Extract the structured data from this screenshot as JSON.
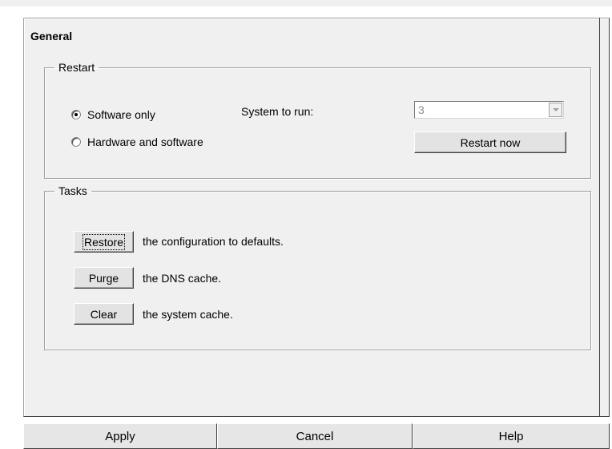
{
  "panel": {
    "title": "General"
  },
  "restart": {
    "legend": "Restart",
    "options": [
      {
        "label": "Software only",
        "selected": true
      },
      {
        "label": "Hardware and software",
        "selected": false
      }
    ],
    "system_label": "System to run:",
    "system_value": "3",
    "restart_button": "Restart now"
  },
  "tasks": {
    "legend": "Tasks",
    "items": [
      {
        "button": "Restore",
        "text": "the configuration to defaults.",
        "focused": true
      },
      {
        "button": "Purge",
        "text": "the DNS cache.",
        "focused": false
      },
      {
        "button": "Clear",
        "text": "the system cache.",
        "focused": false
      }
    ]
  },
  "footer": {
    "apply": "Apply",
    "cancel": "Cancel",
    "help": "Help"
  },
  "icons": {
    "radio_selected": "radio-selected-icon",
    "radio_unselected": "radio-unselected-icon",
    "combo_arrow": "chevron-down-icon"
  },
  "colors": {
    "panel_bg": "#f0f0f0",
    "button_bg": "#e3e3e3",
    "disabled_text": "#8c8c8c"
  }
}
